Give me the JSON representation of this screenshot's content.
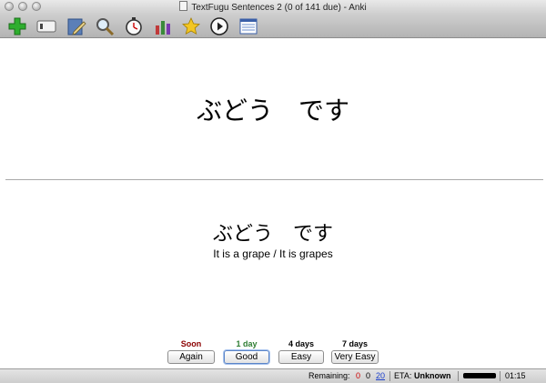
{
  "window": {
    "title": "TextFugu Sentences 2 (0 of 141 due) - Anki"
  },
  "toolbar": {
    "icons": [
      "add-icon",
      "deck-browser-icon",
      "edit-icon",
      "search-icon",
      "timer-icon",
      "statistics-icon",
      "mark-star-icon",
      "play-icon",
      "card-list-icon"
    ]
  },
  "card": {
    "question": "ぶどう　です",
    "answer_japanese": "ぶどう　です",
    "answer_english": "It is a grape / It is grapes"
  },
  "ease_buttons": [
    {
      "due": "Soon",
      "label": "Again",
      "due_color": "#8b0000"
    },
    {
      "due": "1 day",
      "label": "Good",
      "due_color": "#2e7d32",
      "default": true
    },
    {
      "due": "4 days",
      "label": "Easy",
      "due_color": "#000000"
    },
    {
      "due": "7 days",
      "label": "Very Easy",
      "due_color": "#000000"
    }
  ],
  "status": {
    "remaining_label": "Remaining:",
    "remaining_new": "0",
    "remaining_failed": "0",
    "remaining_review": "20",
    "eta_label": "ETA:",
    "eta_value": "Unknown",
    "timer": "01:15",
    "colors": {
      "new": "#cc0000",
      "review": "#1a3fcc"
    }
  }
}
